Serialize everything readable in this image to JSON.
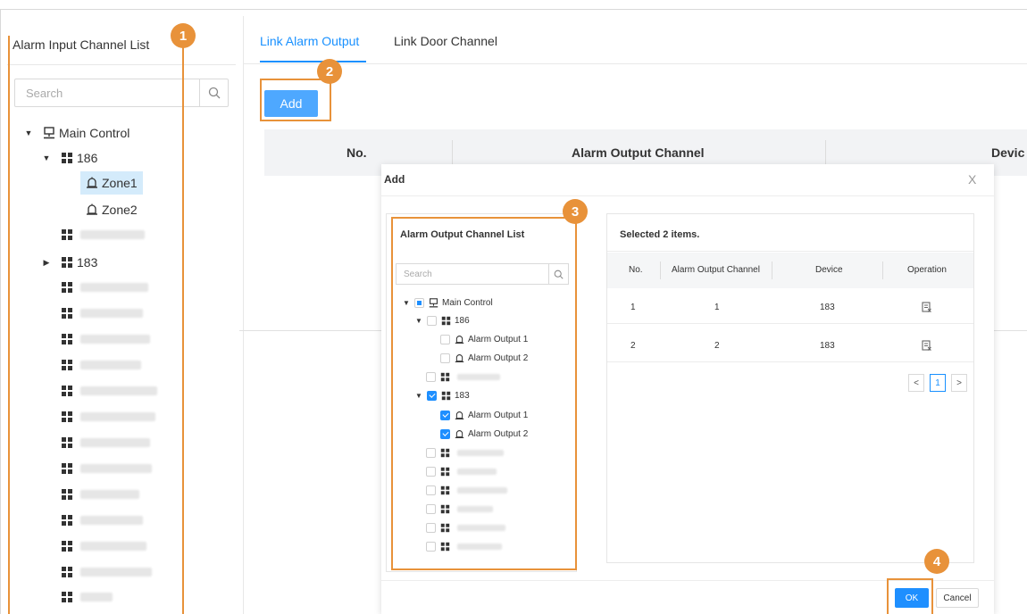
{
  "left_panel": {
    "title": "Alarm Input Channel List",
    "search_placeholder": "Search",
    "root_label": "Main Control",
    "device_186": "186",
    "zones": [
      "Zone1",
      "Zone2"
    ],
    "device_183": "183"
  },
  "tabs": [
    "Link Alarm Output",
    "Link Door Channel"
  ],
  "add_button": "Add",
  "table": {
    "headers": [
      "No.",
      "Alarm Output Channel",
      "Devic"
    ]
  },
  "modal": {
    "title": "Add",
    "close": "X",
    "output_panel": {
      "title": "Alarm Output Channel List",
      "search_placeholder": "Search",
      "root_label": "Main Control",
      "device_186": "186",
      "device_183": "183",
      "outputs": [
        "Alarm Output 1",
        "Alarm Output 2"
      ]
    },
    "selected_panel": {
      "title": "Selected 2 items.",
      "headers": [
        "No.",
        "Alarm Output Channel",
        "Device",
        "Operation"
      ],
      "rows": [
        {
          "no": "1",
          "channel": "1",
          "device": "183"
        },
        {
          "no": "2",
          "channel": "2",
          "device": "183"
        }
      ],
      "pager": {
        "prev": "<",
        "page": "1",
        "next": ">"
      }
    },
    "ok_button": "OK",
    "cancel_button": "Cancel"
  },
  "callouts": [
    "1",
    "2",
    "3",
    "4"
  ],
  "colors": {
    "accent": "#1890ff",
    "callout": "#e8923a",
    "add_button": "#4ea8ff"
  }
}
